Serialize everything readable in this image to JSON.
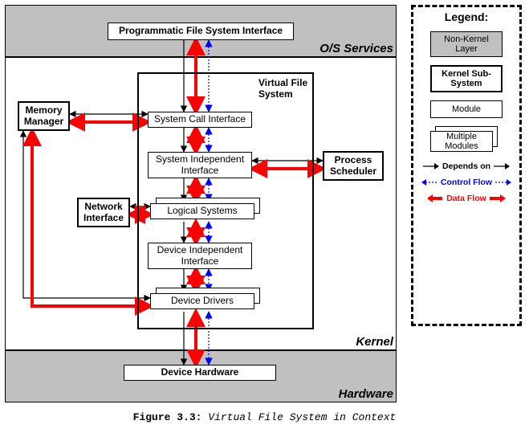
{
  "layers": {
    "os_services": "O/S Services",
    "kernel": "Kernel",
    "hardware": "Hardware"
  },
  "modules": {
    "pfs": "Programmatic File System Interface",
    "mm": "Memory Manager",
    "ni": "Network Interface",
    "ps": "Process Scheduler",
    "sci": "System Call Interface",
    "sii": "System Independent Interface",
    "ls": "Logical Systems",
    "dii": "Device Independent Interface",
    "dd": "Device Drivers",
    "dh": "Device Hardware",
    "vfs": "Virtual File System"
  },
  "legend": {
    "title": "Legend:",
    "nk": "Non-Kernel Layer",
    "ks": "Kernel Sub-System",
    "mod": "Module",
    "mm": "Multiple Modules",
    "dep": "Depends on",
    "cf": "Control Flow",
    "df": "Data Flow"
  },
  "caption": {
    "fig": "Figure 3.3:",
    "title": "Virtual File System in Context"
  },
  "chart_data": {
    "type": "diagram",
    "title": "Virtual File System in Context",
    "layers": [
      {
        "name": "O/S Services",
        "kind": "non-kernel",
        "contains": [
          "Programmatic File System Interface"
        ]
      },
      {
        "name": "Kernel",
        "kind": "kernel",
        "contains": [
          "Memory Manager",
          "Network Interface",
          "Process Scheduler",
          "Virtual File System"
        ]
      },
      {
        "name": "Hardware",
        "kind": "non-kernel",
        "contains": [
          "Device Hardware"
        ]
      }
    ],
    "virtual_file_system_stack": [
      "System Call Interface",
      "System Independent Interface",
      "Logical Systems",
      "Device Independent Interface",
      "Device Drivers"
    ],
    "multi_instance_modules": [
      "Logical Systems",
      "Device Drivers"
    ],
    "edges": [
      {
        "from": "Programmatic File System Interface",
        "to": "System Call Interface",
        "types": [
          "depends",
          "control",
          "data"
        ]
      },
      {
        "from": "System Call Interface",
        "to": "System Independent Interface",
        "types": [
          "depends",
          "control",
          "data"
        ]
      },
      {
        "from": "System Independent Interface",
        "to": "Logical Systems",
        "types": [
          "depends",
          "control",
          "data"
        ]
      },
      {
        "from": "Logical Systems",
        "to": "Device Independent Interface",
        "types": [
          "depends",
          "control",
          "data"
        ]
      },
      {
        "from": "Device Independent Interface",
        "to": "Device Drivers",
        "types": [
          "depends",
          "control",
          "data"
        ]
      },
      {
        "from": "Device Drivers",
        "to": "Device Hardware",
        "types": [
          "depends",
          "control",
          "data"
        ]
      },
      {
        "from": "Memory Manager",
        "to": "System Call Interface",
        "types": [
          "depends",
          "data"
        ]
      },
      {
        "from": "Memory Manager",
        "to": "Device Drivers",
        "types": [
          "depends",
          "data"
        ]
      },
      {
        "from": "Network Interface",
        "to": "Logical Systems",
        "types": [
          "depends",
          "data"
        ]
      },
      {
        "from": "System Independent Interface",
        "to": "Process Scheduler",
        "types": [
          "depends",
          "data"
        ]
      }
    ],
    "legend": {
      "Non-Kernel Layer": "grey filled box, thin border",
      "Kernel Sub-System": "thick bordered box",
      "Module": "thin bordered box",
      "Multiple Modules": "stacked thin boxes",
      "Depends on": "solid black thin arrow",
      "Control Flow": "dotted blue double arrow",
      "Data Flow": "thick red double arrow"
    }
  }
}
